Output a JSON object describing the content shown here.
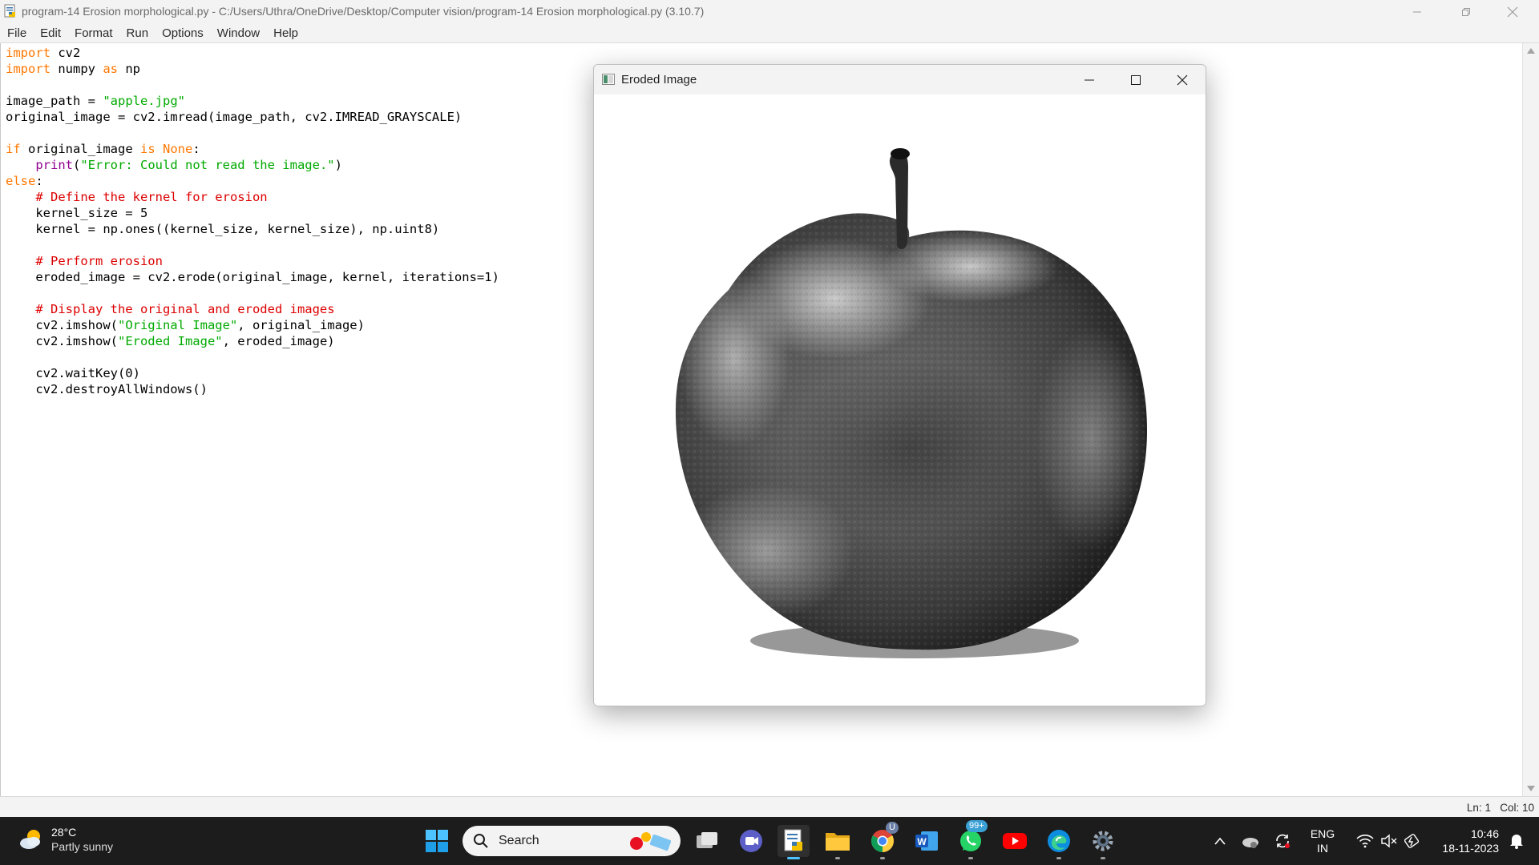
{
  "window": {
    "title": "program-14 Erosion morphological.py - C:/Users/Uthra/OneDrive/Desktop/Computer vision/program-14 Erosion morphological.py (3.10.7)",
    "menu": [
      "File",
      "Edit",
      "Format",
      "Run",
      "Options",
      "Window",
      "Help"
    ]
  },
  "code_lines": [
    [
      {
        "t": "import",
        "c": "kw"
      },
      {
        "t": " cv2"
      }
    ],
    [
      {
        "t": "import",
        "c": "kw"
      },
      {
        "t": " numpy "
      },
      {
        "t": "as",
        "c": "kw"
      },
      {
        "t": " np"
      }
    ],
    [],
    [
      {
        "t": "image_path = "
      },
      {
        "t": "\"apple.jpg\"",
        "c": "st"
      }
    ],
    [
      {
        "t": "original_image = cv2.imread(image_path, cv2.IMREAD_GRAYSCALE)"
      }
    ],
    [],
    [
      {
        "t": "if",
        "c": "kw"
      },
      {
        "t": " original_image "
      },
      {
        "t": "is",
        "c": "kw"
      },
      {
        "t": " "
      },
      {
        "t": "None",
        "c": "kw"
      },
      {
        "t": ":"
      }
    ],
    [
      {
        "t": "    "
      },
      {
        "t": "print",
        "c": "bi"
      },
      {
        "t": "("
      },
      {
        "t": "\"Error: Could not read the image.\"",
        "c": "st"
      },
      {
        "t": ")"
      }
    ],
    [
      {
        "t": "else",
        "c": "kw"
      },
      {
        "t": ":"
      }
    ],
    [
      {
        "t": "    "
      },
      {
        "t": "# Define the kernel for erosion",
        "c": "cm"
      }
    ],
    [
      {
        "t": "    kernel_size = 5"
      }
    ],
    [
      {
        "t": "    kernel = np.ones((kernel_size, kernel_size), np.uint8)"
      }
    ],
    [],
    [
      {
        "t": "    "
      },
      {
        "t": "# Perform erosion",
        "c": "cm"
      }
    ],
    [
      {
        "t": "    eroded_image = cv2.erode(original_image, kernel, iterations=1)"
      }
    ],
    [],
    [
      {
        "t": "    "
      },
      {
        "t": "# Display the original and eroded images",
        "c": "cm"
      }
    ],
    [
      {
        "t": "    cv2.imshow("
      },
      {
        "t": "\"Original Image\"",
        "c": "st"
      },
      {
        "t": ", original_image)"
      }
    ],
    [
      {
        "t": "    cv2.imshow("
      },
      {
        "t": "\"Eroded Image\"",
        "c": "st"
      },
      {
        "t": ", eroded_image)"
      }
    ],
    [],
    [
      {
        "t": "    cv2.waitKey(0)"
      }
    ],
    [
      {
        "t": "    cv2.destroyAllWindows()"
      }
    ]
  ],
  "status": {
    "line": "Ln: 1",
    "col": "Col: 10"
  },
  "image_window": {
    "title": "Eroded Image"
  },
  "taskbar": {
    "weather_temp": "28°C",
    "weather_desc": "Partly sunny",
    "search_placeholder": "Search",
    "apps": [
      "windows-start-icon",
      "task-view-icon",
      "chat-icon",
      "idle-icon",
      "file-explorer-icon",
      "chrome-icon",
      "word-icon",
      "whatsapp-icon",
      "youtube-icon",
      "edge-icon",
      "settings-icon"
    ],
    "whatsapp_badge": "99+",
    "chrome_badge": "U",
    "lang_top": "ENG",
    "lang_bottom": "IN",
    "time": "10:46",
    "date": "18-11-2023"
  }
}
